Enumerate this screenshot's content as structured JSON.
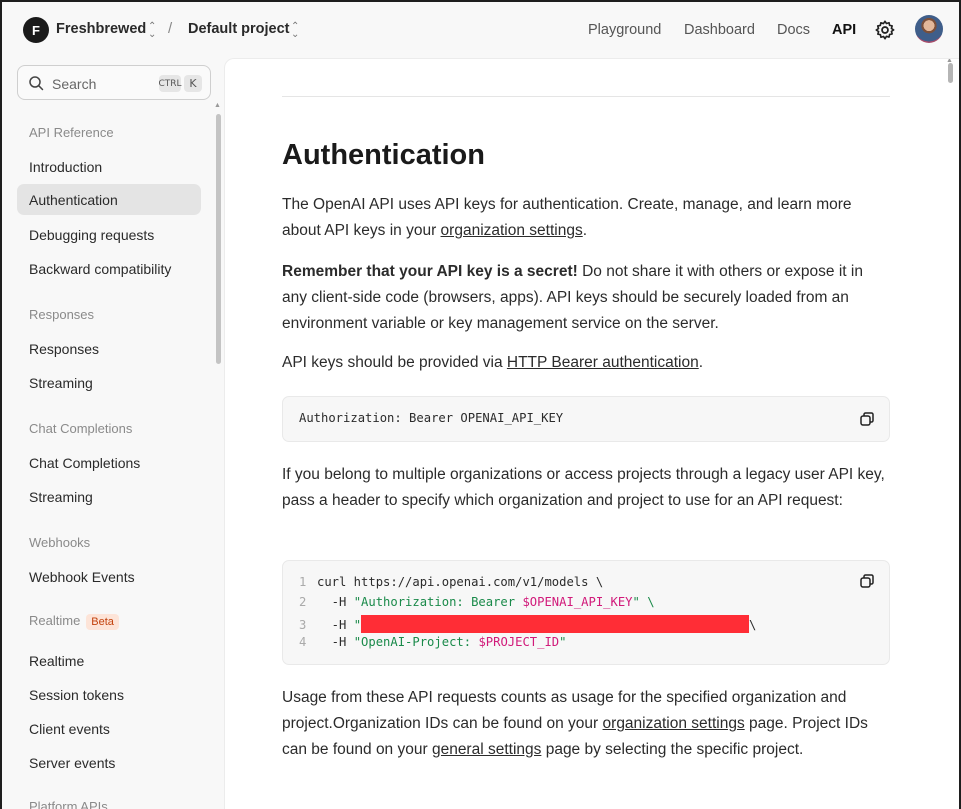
{
  "topbar": {
    "org_initial": "F",
    "org_name": "Freshbrewed",
    "separator": "/",
    "project_name": "Default project",
    "nav": [
      "Playground",
      "Dashboard",
      "Docs",
      "API"
    ],
    "active_nav": "API"
  },
  "sidebar": {
    "search_placeholder": "Search",
    "shortcut_ctrl": "CTRL",
    "shortcut_key": "K",
    "sections": [
      {
        "title": "API Reference",
        "items": [
          "Introduction",
          "Authentication",
          "Debugging requests",
          "Backward compatibility"
        ]
      },
      {
        "title": "Responses",
        "items": [
          "Responses",
          "Streaming"
        ]
      },
      {
        "title": "Chat Completions",
        "items": [
          "Chat Completions",
          "Streaming"
        ]
      },
      {
        "title": "Webhooks",
        "items": [
          "Webhook Events"
        ]
      },
      {
        "title": "Realtime",
        "badge": "Beta",
        "items": [
          "Realtime",
          "Session tokens",
          "Client events",
          "Server events"
        ]
      },
      {
        "title": "Platform APIs",
        "items": []
      }
    ],
    "active_item": "Authentication"
  },
  "content": {
    "heading": "Authentication",
    "p1_before": "The OpenAI API uses API keys for authentication. Create, manage, and learn more about API keys in your ",
    "p1_link": "organization settings",
    "p1_after": ".",
    "p2_bold": "Remember that your API key is a secret!",
    "p2_rest": " Do not share it with others or expose it in any client-side code (browsers, apps). API keys should be securely loaded from an environment variable or key management service on the server.",
    "p3_before": "API keys should be provided via ",
    "p3_link": "HTTP Bearer authentication",
    "p3_after": ".",
    "code1": "Authorization: Bearer OPENAI_API_KEY",
    "p4": "If you belong to multiple organizations or access projects through a legacy user API key, pass a header to specify which organization and project to use for an API request:",
    "code2": {
      "line1_num": "1",
      "line1": "curl https://api.openai.com/v1/models \\",
      "line2_num": "2",
      "line2_pre": "  -H ",
      "line2_str": "\"Authorization: Bearer ",
      "line2_var": "$OPENAI_API_KEY",
      "line2_end": "\" \\",
      "line3_num": "3",
      "line3_pre": "  -H ",
      "line3_str": "\"",
      "line3_end": "\\",
      "line4_num": "4",
      "line4_pre": "  -H ",
      "line4_str": "\"OpenAI-Project: ",
      "line4_var": "$PROJECT_ID",
      "line4_end": "\""
    },
    "p5_before": "Usage from these API requests counts as usage for the specified organization and project.Organization IDs can be found on your ",
    "p5_link1": "organization settings",
    "p5_mid": " page. Project IDs can be found on your ",
    "p5_link2": "general settings",
    "p5_after": " page by selecting the specific project."
  },
  "colors": {
    "code_string": "#1a8a4a",
    "code_variable": "#d11a7a",
    "redaction": "#ff2d36",
    "beta_badge": "#c2410c"
  }
}
